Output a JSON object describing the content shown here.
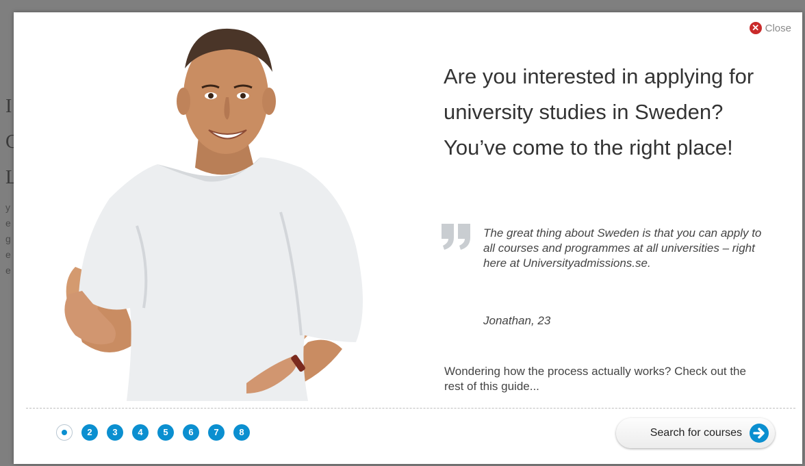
{
  "background": {
    "letters": [
      "I",
      "C",
      "L"
    ],
    "small_letters": [
      "y",
      "e",
      "g",
      "e",
      "e"
    ]
  },
  "modal": {
    "close_label": "Close",
    "headline": "Are you interested in applying for university studies in Sweden? You’ve come to the right place!",
    "quote": "The great thing about Sweden is that you can apply to all courses and programmes at all universities – right here at Universityadmissions.se.",
    "quote_author": "Jonathan, 23",
    "cta_text": "Wondering how the process actually works? Check out the rest of this guide...",
    "pager": [
      "2",
      "3",
      "4",
      "5",
      "6",
      "7",
      "8"
    ],
    "current_page": 1,
    "search_button": "Search for courses"
  },
  "colors": {
    "accent": "#0b8fd0",
    "close": "#c92a2a"
  },
  "icons": {
    "close": "close-icon",
    "quote": "quote-icon",
    "arrow": "arrow-right-icon"
  }
}
